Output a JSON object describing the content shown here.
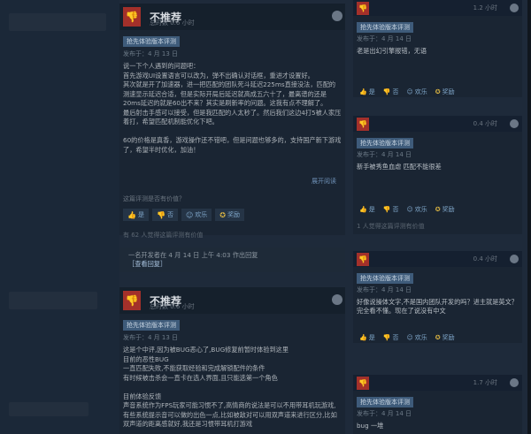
{
  "reviews": [
    {
      "recommend": "不推荐",
      "hours": "总时数 0.6 小时",
      "chip": "抢先体验版本评测",
      "posted": "发布于：4 月 13 日",
      "body": "说一下个人遇到的问题吧：\n首先游戏UI设置语言可以改为，弹不出确认对话框，重进才设置好。\n其次就是开了加速器，进一把匹配的团队死斗延迟225ms直接没法，匹配的测速显示延迟合适，但是实际开局后延迟就高成五六十了，最离谱的还是20ms延迟的就是60出不来？其实是刷新率的问题。这我有点不理解了。\n最后射击手感可以接受，但是我匹配的人太秒了。然后我们这边4打5被人家压着打，希望匹配机制能优化下吧。\n\n60的价格是真香，游戏操作还不错吧，但是问题也够多的，支持国产新下游戏了，希望半时优化，加油！",
      "expand": "展开阅读",
      "helpful_q": "这篇评测是否有价值？",
      "votes": [
        "是",
        "否",
        "欢乐",
        "奖励"
      ],
      "found": "有 62 人觉得这篇评测有价值",
      "dev_response": "一名开发者在 4 月 14 日 上午 4:03 作出回复",
      "dev_link": "［查看回复］"
    },
    {
      "recommend": "不推荐",
      "hours": "总时数 0.6 小时",
      "chip": "抢先体验版本评测",
      "posted": "发布于：4 月 13 日",
      "body": "这是个中评,因为被BUG恶心了,BUG修复前暂时体验到这里\n目前的恶性BUG\n一直匹配失败,不能获取经验和完成解锁配件的条件\n有时候被击杀会一直卡在选人界面,且只能选第一个角色\n\n目前体验反馈\n声音系统作为FPS玩家可能习惯不了,高情商的说法是可以不用带耳机玩游戏,有些系统提示音可以做的出色一点,比如被敌对可以用双声道来进行区分,比如双声道的距离感就好,我还是习惯带耳机打游戏"
    }
  ],
  "side_reviews": [
    {
      "hours": "1.2 小时",
      "chip": "抢先体验版本评测",
      "posted": "发布于：4 月 14 日",
      "text": "老是出幻引擎报错，无语",
      "votes": [
        "是",
        "否",
        "欢乐",
        "奖励"
      ],
      "found": ""
    },
    {
      "hours": "0.4 小时",
      "chip": "抢先体验版本评测",
      "posted": "发布于：4 月 14 日",
      "text": "新手被秀鱼血虐 匹配不能很差",
      "votes": [
        "是",
        "否",
        "欢乐",
        "奖励"
      ],
      "found": "1 人觉得这篇评测有价值"
    },
    {
      "hours": "0.4 小时",
      "chip": "抢先体验版本评测",
      "posted": "发布于：4 月 14 日",
      "text": "好像说操体文字,不是国内团队开发的吗？进主就是英文？完全看不懂。现在了说没有中文",
      "votes": [
        "是",
        "否",
        "欢乐",
        "奖励"
      ],
      "found": ""
    },
    {
      "hours": "1.7 小时",
      "chip": "抢先体验版本评测",
      "posted": "发布于：4 月 14 日",
      "text": "bug 一堆",
      "votes": [],
      "found": ""
    }
  ]
}
